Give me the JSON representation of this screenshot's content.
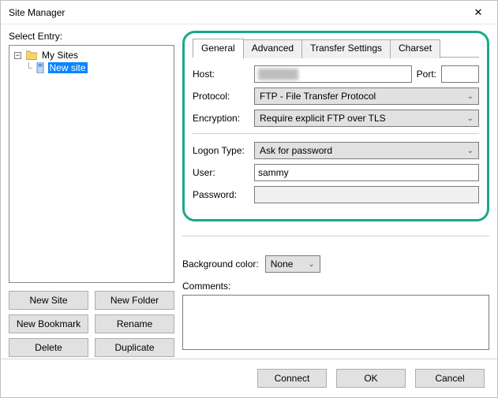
{
  "window": {
    "title": "Site Manager",
    "close_glyph": "✕"
  },
  "left": {
    "label": "Select Entry:",
    "root_label": "My Sites",
    "child_label": "New site",
    "buttons": {
      "new_site": "New Site",
      "new_folder": "New Folder",
      "new_bookmark": "New Bookmark",
      "rename": "Rename",
      "delete": "Delete",
      "duplicate": "Duplicate"
    }
  },
  "tabs": {
    "general": "General",
    "advanced": "Advanced",
    "transfer": "Transfer Settings",
    "charset": "Charset",
    "active": "general"
  },
  "form": {
    "host_label": "Host:",
    "host_value": "",
    "host_blurred_placeholder": "██████",
    "port_label": "Port:",
    "port_value": "",
    "protocol_label": "Protocol:",
    "protocol_value": "FTP - File Transfer Protocol",
    "encryption_label": "Encryption:",
    "encryption_value": "Require explicit FTP over TLS",
    "logon_label": "Logon Type:",
    "logon_value": "Ask for password",
    "user_label": "User:",
    "user_value": "sammy",
    "password_label": "Password:",
    "password_value": ""
  },
  "background": {
    "label": "Background color:",
    "value": "None"
  },
  "comments": {
    "label": "Comments:",
    "value": ""
  },
  "bottom": {
    "connect": "Connect",
    "ok": "OK",
    "cancel": "Cancel"
  },
  "glyphs": {
    "chevron_down": "⌄",
    "minus": "−"
  }
}
